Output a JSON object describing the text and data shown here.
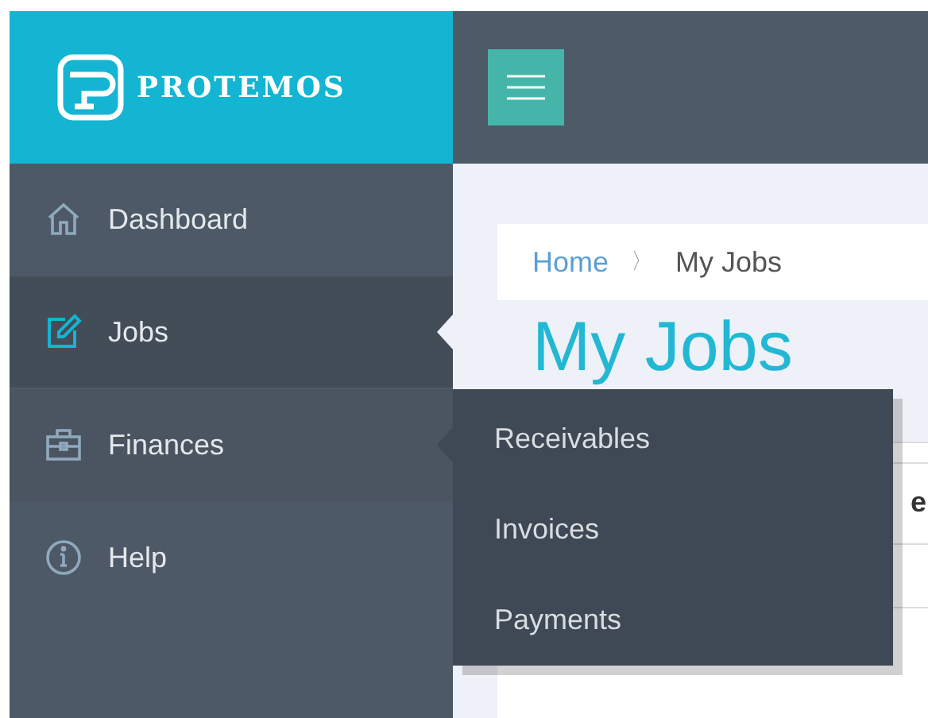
{
  "logo": {
    "text": "PROTEMOS"
  },
  "sidebar": {
    "items": [
      {
        "label": "Dashboard",
        "selected": false,
        "expanded": false
      },
      {
        "label": "Jobs",
        "selected": true,
        "expanded": false
      },
      {
        "label": "Finances",
        "selected": false,
        "expanded": true,
        "children": [
          {
            "label": "Receivables"
          },
          {
            "label": "Invoices"
          },
          {
            "label": "Payments"
          }
        ]
      },
      {
        "label": "Help",
        "selected": false,
        "expanded": false
      }
    ]
  },
  "breadcrumb": {
    "items": [
      "Home",
      "My Jobs"
    ],
    "separator": "〉"
  },
  "page_title": "My Jobs",
  "table": {
    "columns": [
      "e"
    ]
  }
}
